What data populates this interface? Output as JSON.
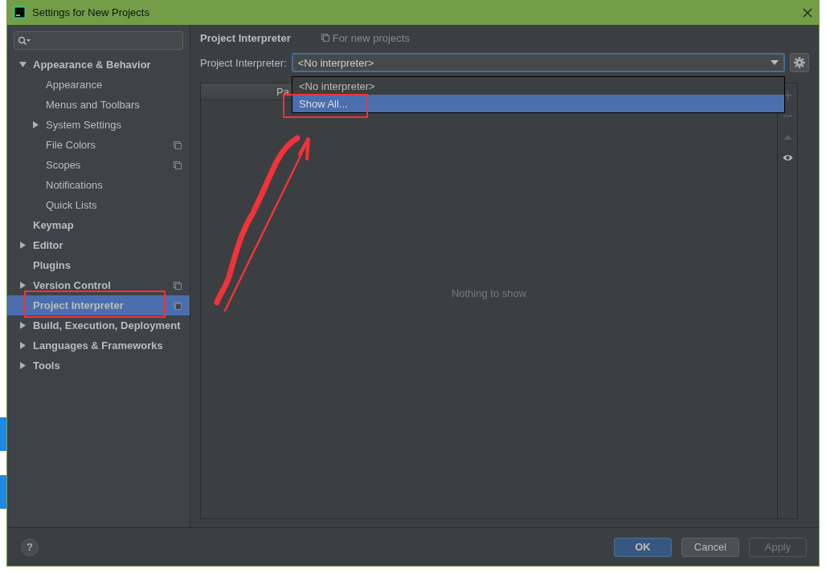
{
  "window": {
    "title": "Settings for New Projects"
  },
  "help": "?",
  "tree": [
    {
      "label": "Appearance & Behavior",
      "expanded": true,
      "selected": false,
      "project_scoped": false,
      "children": [
        {
          "label": "Appearance",
          "selected": false,
          "project_scoped": false
        },
        {
          "label": "Menus and Toolbars",
          "selected": false,
          "project_scoped": false
        },
        {
          "label": "System Settings",
          "expanded": false,
          "selected": false,
          "project_scoped": false
        },
        {
          "label": "File Colors",
          "selected": false,
          "project_scoped": true
        },
        {
          "label": "Scopes",
          "selected": false,
          "project_scoped": true
        },
        {
          "label": "Notifications",
          "selected": false,
          "project_scoped": false
        },
        {
          "label": "Quick Lists",
          "selected": false,
          "project_scoped": false
        }
      ]
    },
    {
      "label": "Keymap",
      "selected": false,
      "project_scoped": false
    },
    {
      "label": "Editor",
      "expanded": false,
      "selected": false,
      "project_scoped": false
    },
    {
      "label": "Plugins",
      "selected": false,
      "project_scoped": false
    },
    {
      "label": "Version Control",
      "expanded": false,
      "selected": false,
      "project_scoped": true
    },
    {
      "label": "Project Interpreter",
      "selected": true,
      "project_scoped": true
    },
    {
      "label": "Build, Execution, Deployment",
      "expanded": false,
      "selected": false,
      "project_scoped": false
    },
    {
      "label": "Languages & Frameworks",
      "expanded": false,
      "selected": false,
      "project_scoped": false
    },
    {
      "label": "Tools",
      "expanded": false,
      "selected": false,
      "project_scoped": false
    }
  ],
  "panel": {
    "title": "Project Interpreter",
    "scope_note": "For new projects",
    "interpreter_label": "Project Interpreter:",
    "interpreter_value": "<No interpreter>",
    "dropdown": [
      {
        "label": "<No interpreter>",
        "selected": false
      },
      {
        "label": "Show All...",
        "selected": true
      }
    ],
    "table": {
      "column_1": "Pa",
      "empty_text": "Nothing to show"
    }
  },
  "buttons": [
    {
      "label": "OK",
      "kind": "default",
      "disabled": false
    },
    {
      "label": "Cancel",
      "kind": "normal",
      "disabled": false
    },
    {
      "label": "Apply",
      "kind": "normal",
      "disabled": true
    }
  ]
}
